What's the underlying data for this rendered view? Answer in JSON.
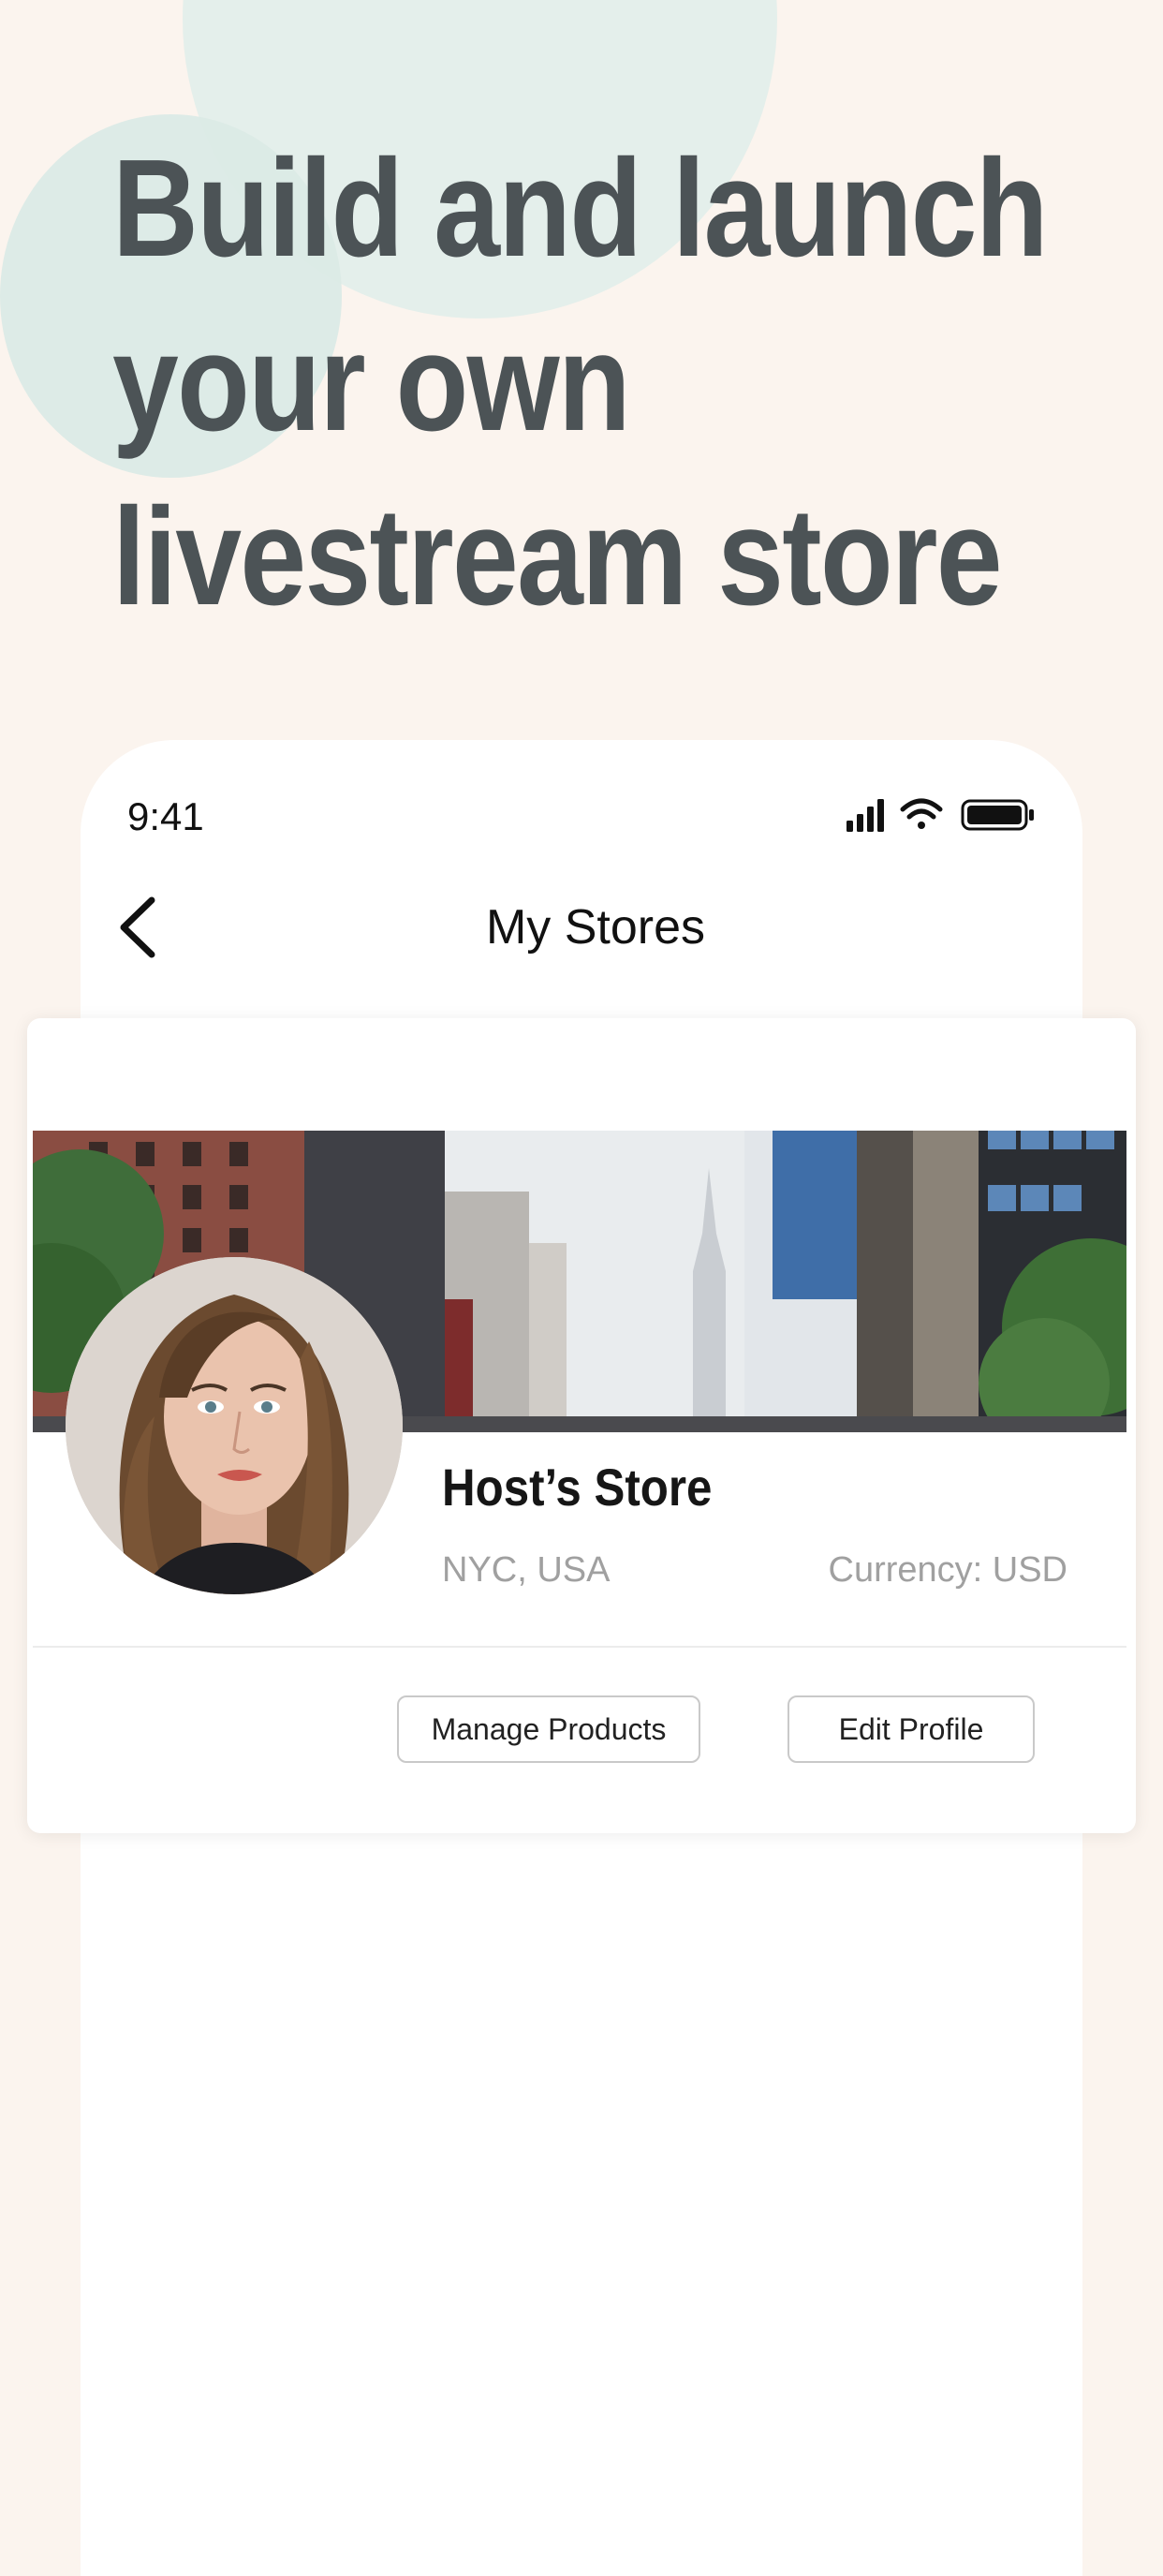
{
  "headline": {
    "line1": "Build and launch",
    "line2": "your own",
    "line3": "livestream store"
  },
  "status_bar": {
    "time": "9:41"
  },
  "nav": {
    "title": "My Stores"
  },
  "store": {
    "name": "Host’s Store",
    "location": "NYC, USA",
    "currency": "Currency: USD",
    "manage_products_label": "Manage Products",
    "edit_profile_label": "Edit Profile"
  },
  "colors": {
    "background": "#fbf4ee",
    "headline": "#4c5356",
    "accent_circle": "#e3eeea"
  },
  "icons": {
    "back": "chevron-left-icon",
    "signal": "cellular-signal-icon",
    "wifi": "wifi-icon",
    "battery": "battery-icon"
  }
}
